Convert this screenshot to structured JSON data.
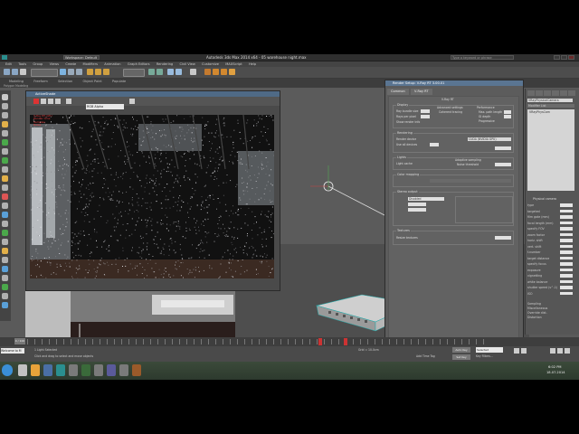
{
  "app": {
    "title": "Autodesk 3ds Max 2014 x64 - 05 warehouse night.max",
    "workspace": "Workspace: Default",
    "search_placeholder": "Type a keyword or phrase"
  },
  "menus": [
    "Edit",
    "Tools",
    "Group",
    "Views",
    "Create",
    "Modifiers",
    "Animation",
    "Graph Editors",
    "Rendering",
    "Civil View",
    "Customize",
    "MAXScript",
    "Help"
  ],
  "ribbon": {
    "tabs": [
      "Modeling",
      "Freeform",
      "Selection",
      "Object Paint",
      "Populate"
    ],
    "sub": "Polygon Modeling"
  },
  "render_frame": {
    "title": "ActiveShade",
    "channel": "RGB Alpha",
    "overlay_lines": [
      "V-Ray RT GPU",
      "Render time",
      "Samples",
      "Noise"
    ]
  },
  "render_setup": {
    "title": "Render Setup: V-Ray RT 3.00.01",
    "tabs": [
      "Common",
      "V-Ray RT"
    ],
    "panel": "V-Ray RT",
    "groups": {
      "display": "Display",
      "advanced": "Advanced settings",
      "performance": "Performance",
      "rendering": "Rendering",
      "lights": "Lights",
      "adaptive": "Adaptive sampling",
      "color": "Color mapping",
      "stereo": "Stereo output",
      "textures": "Textures"
    },
    "labels": {
      "engine": "Render device",
      "device_value": "CUDA (NVIDIA GPU)",
      "show_pct": "Show render info",
      "ray_bundle": "Ray bundle size",
      "rays_per_pixel": "Rays per pixel",
      "max_path": "Max. path length",
      "use_all": "Use all devices",
      "gi_depth": "GI depth",
      "coherent": "Coherent tracing",
      "progressive": "Progressive",
      "ray_bund_val": "128",
      "rpp_val": "16",
      "light_cache": "Light cache",
      "adaptive_label": "Noise threshold",
      "stereo_val": "Disabled",
      "tex_note": "Resize textures"
    },
    "footer": {
      "preset_label": "Preset:",
      "preset_value": "---------------",
      "view_label": "View:",
      "view_value": "Quad 4 - Perspective",
      "button": "ActiveShade"
    }
  },
  "command_panel": {
    "object_name": "VRayPhysicalCamera",
    "modifier_list": "Modifier List",
    "stack_item": "VRayPhysCam",
    "rollout": "Physical camera",
    "params": [
      "type",
      "targeted",
      "film gate (mm)",
      "focal length (mm)",
      "specify FOV",
      "zoom factor",
      "horiz. shift",
      "vert. shift",
      "f-number",
      "target distance",
      "specify focus",
      "exposure",
      "vignetting",
      "white balance",
      "shutter speed (s^-1)",
      "ISO"
    ],
    "footer": [
      "Sampling",
      "Miscellaneous",
      "Override dist.",
      "Distortion"
    ]
  },
  "timeline": {
    "frame": "0 / 100"
  },
  "status": {
    "left": "Welcome to M",
    "selection": "1 Light Selected",
    "hint": "Click and drag to select and move objects",
    "grid": "Grid = 10.0cm",
    "add_time_tag": "Add Time Tag",
    "auto_key": "Auto Key",
    "set_key": "Set Key",
    "key_filter": "Key Filters...",
    "selected": "Selected"
  },
  "taskbar": {
    "time": "6:02 PM",
    "date": "18.07.2014"
  },
  "colors": {
    "accent": "#5a7592",
    "panel": "#5c5c5c",
    "viewport": "#5b5b5b"
  }
}
